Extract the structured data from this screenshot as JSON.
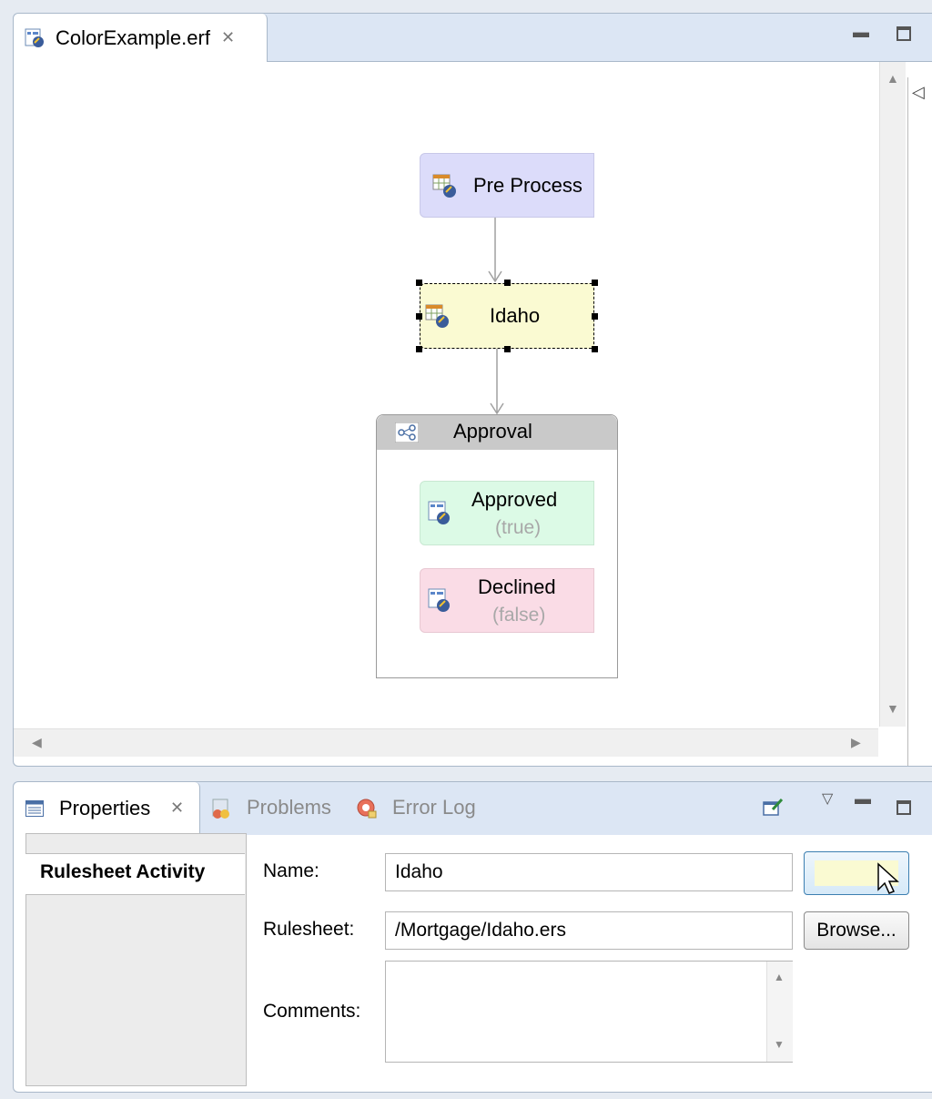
{
  "editor": {
    "tab_title": "ColorExample.erf",
    "close_glyph": "⊠",
    "minimize_glyph": "▭",
    "maximize_glyph": "☐"
  },
  "diagram": {
    "nodes": {
      "pre_process": {
        "label": "Pre Process",
        "fill": "#dcdcfa",
        "icon": "rulesheet-icon"
      },
      "idaho": {
        "label": "Idaho",
        "fill": "#fafad2",
        "icon": "rulesheet-icon",
        "selected": true
      },
      "approval": {
        "label": "Approval",
        "header_fill": "#c9c9c9",
        "icon": "branch-icon"
      },
      "approved": {
        "label": "Approved",
        "condition": "(true)",
        "fill": "#dcfae6",
        "icon": "ruleflow-icon"
      },
      "declined": {
        "label": "Declined",
        "condition": "(false)",
        "fill": "#fadce6",
        "icon": "ruleflow-icon"
      }
    }
  },
  "properties": {
    "tabs": [
      {
        "label": "Properties",
        "icon": "properties-icon",
        "active": true
      },
      {
        "label": "Problems",
        "icon": "problems-icon",
        "active": false
      },
      {
        "label": "Error Log",
        "icon": "error-log-icon",
        "active": false
      }
    ],
    "section": "Rulesheet Activity",
    "name_label": "Name:",
    "name_value": "Idaho",
    "color_swatch": "#fafad2",
    "rulesheet_label": "Rulesheet:",
    "rulesheet_value": "/Mortgage/Idaho.ers",
    "browse_label": "Browse...",
    "comments_label": "Comments:",
    "comments_value": ""
  }
}
